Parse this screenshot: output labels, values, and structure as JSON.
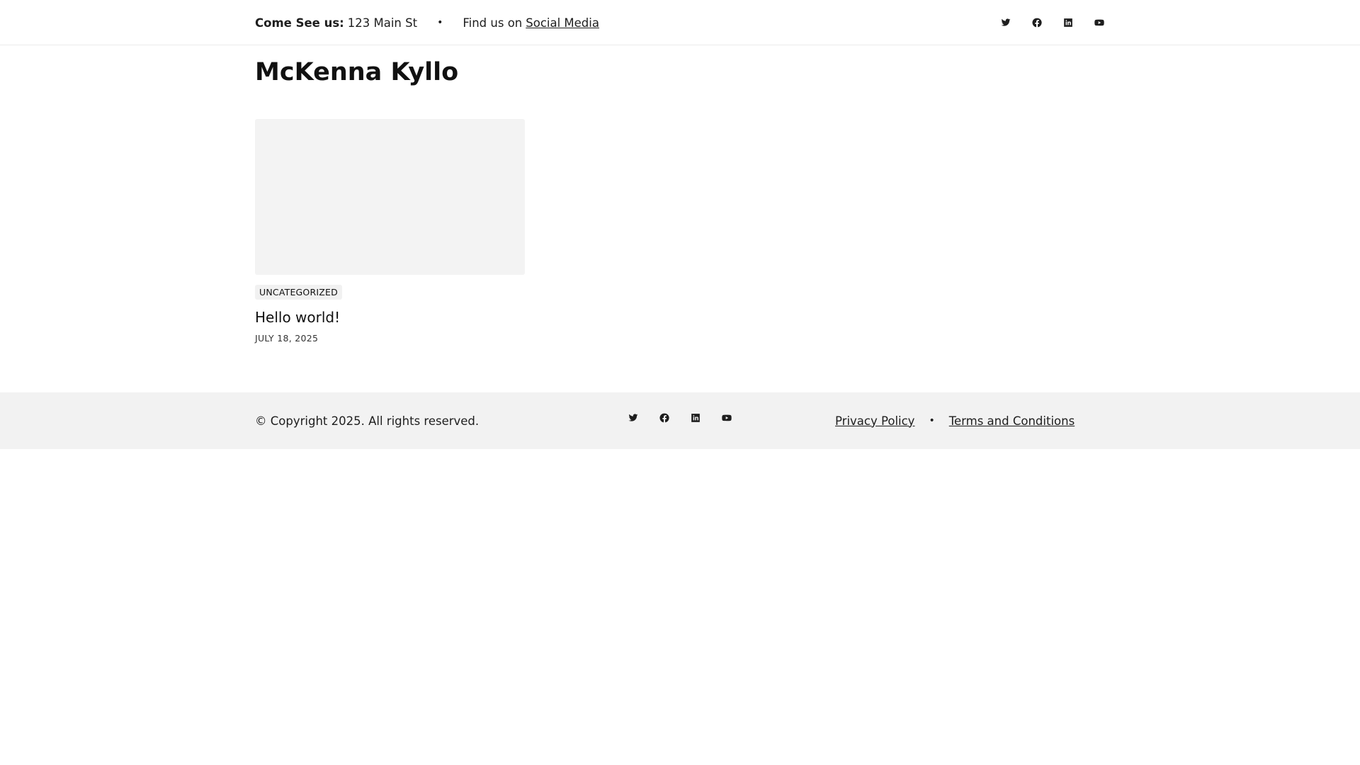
{
  "topbar": {
    "address_label": "Come See us:",
    "address_value": "123 Main St",
    "separator": "•",
    "find_label": "Find us on",
    "social_link": "Social Media",
    "social_icons": [
      "twitter-icon",
      "facebook-icon",
      "linkedin-icon",
      "youtube-icon"
    ]
  },
  "site": {
    "title": "McKenna Kyllo"
  },
  "posts": [
    {
      "category": "UNCATEGORIZED",
      "title": "Hello world!",
      "date": "JULY 18, 2025"
    }
  ],
  "footer": {
    "copyright": "© Copyright 2025. All rights reserved.",
    "social_icons": [
      "twitter-icon",
      "facebook-icon",
      "linkedin-icon",
      "youtube-icon"
    ],
    "links": [
      {
        "label": "Privacy Policy"
      },
      {
        "label": "Terms and Conditions"
      }
    ],
    "separator": "•"
  },
  "colors": {
    "text": "#1e1e1e",
    "footer_bg": "#f2f2f2",
    "thumb_bg": "#f3f3f3",
    "badge_bg": "#f1f1f1"
  }
}
